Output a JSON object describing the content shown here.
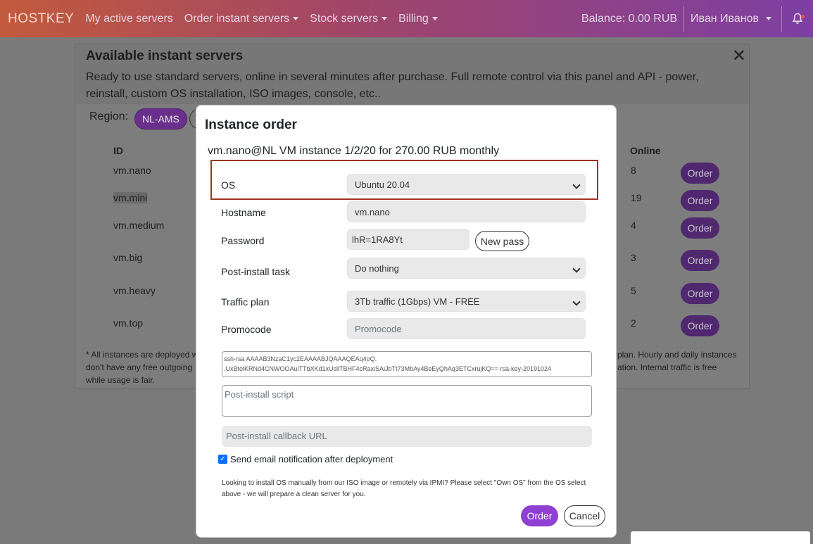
{
  "navbar": {
    "brand": "HOSTKEY",
    "items": [
      {
        "label": "My active servers",
        "dropdown": false
      },
      {
        "label": "Order instant servers",
        "dropdown": true
      },
      {
        "label": "Stock servers",
        "dropdown": true
      },
      {
        "label": "Billing",
        "dropdown": true
      }
    ],
    "balance": "Balance: 0.00 RUB",
    "user": "Иван Иванов"
  },
  "card": {
    "title": "Available instant servers",
    "description": "Ready to use standard servers, online in several minutes after purchase. Full remote control via this panel and API - power, reinstall, custom OS installation, ISO images, console, etc..",
    "close": "✕",
    "region_label": "Region:",
    "region_selected": "NL-AMS",
    "columns": {
      "id": "ID",
      "online": "Online"
    },
    "rows": [
      {
        "id": "vm.nano",
        "online": "8",
        "order": "Order"
      },
      {
        "id": "vm.mini",
        "online": "19",
        "order": "Order"
      },
      {
        "id": "vm.medium",
        "online": "4",
        "order": "Order"
      },
      {
        "id": "vm.big",
        "online": "3",
        "order": "Order"
      },
      {
        "id": "vm.heavy",
        "online": "5",
        "order": "Order"
      },
      {
        "id": "vm.top",
        "online": "2",
        "order": "Order"
      }
    ],
    "footnote_left": "* All instances are deployed w don't have any free outgoing while usage is fair.",
    "footnote_right": "plan. Hourly and daily instances ation. Internal traffic is free"
  },
  "modal": {
    "title": "Instance order",
    "subtitle": "vm.nano@NL VM instance 1/2/20 for 270.00 RUB monthly",
    "fields": {
      "os_label": "OS",
      "os_value": "Ubuntu 20.04",
      "hostname_label": "Hostname",
      "hostname_value": "vm.nano",
      "password_label": "Password",
      "password_value": "lhR=1RA8Yt",
      "new_pass": "New pass",
      "post_install_label": "Post-install task",
      "post_install_value": "Do nothing",
      "traffic_label": "Traffic plan",
      "traffic_value": "3Tb traffic (1Gbps) VM - FREE",
      "promocode_label": "Promocode",
      "promocode_placeholder": "Promocode"
    },
    "ssh_key": "ssh-rsa AAAAB3NzaC1yc2EAAAABJQAAAQEAq4oQ. .UxBtolKRNd4CNWOOAuiTTbXKd1xUsllTBHF4cRaxiSAiJbTt73MbAy4BeEyQhAq3ETCxrujKQ== rsa-key-20191024",
    "script_placeholder": "Post-install script",
    "callback_placeholder": "Post-install callback URL",
    "email_notify_label": "Send email notification after deployment",
    "email_notify_checked": true,
    "note": "Looking to install OS manually from our ISO image or remotely via IPMI? Please select \"Own OS\" from the OS select above - we will prepare a clean server for you.",
    "order_button": "Order",
    "cancel_button": "Cancel"
  }
}
